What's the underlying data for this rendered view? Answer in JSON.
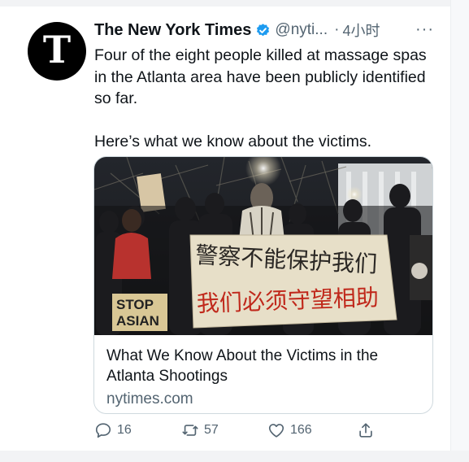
{
  "tweet": {
    "author_name": "The New York Times",
    "handle": "@nyti...",
    "separator": "·",
    "time": "4小时",
    "more": "···",
    "avatar_glyph": "T",
    "text_lines": [
      "Four of the eight people killed at massage spas in the Atlanta area have been publicly identified so far.",
      "Here’s what we know about the victims."
    ]
  },
  "card": {
    "title": "What We Know About the Victims in the Atlanta Shootings",
    "domain": "nytimes.com",
    "image": {
      "banner_line1": "警察不能保护我们",
      "banner_line2": "我们必须守望相助",
      "sign_line1": "STOP",
      "sign_line2": "ASIAN"
    }
  },
  "actions": {
    "reply_count": "16",
    "retweet_count": "57",
    "like_count": "166"
  },
  "colors": {
    "text_primary": "#0f1419",
    "text_secondary": "#536471",
    "verified_blue": "#1d9bf0",
    "banner_red": "#c0281b"
  },
  "icons": [
    "verified-badge-icon",
    "reply-icon",
    "retweet-icon",
    "like-icon",
    "share-icon"
  ]
}
